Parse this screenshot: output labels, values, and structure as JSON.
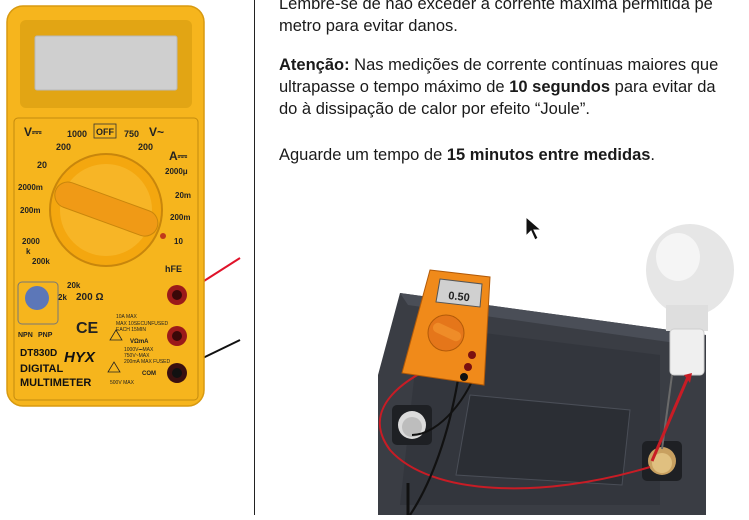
{
  "paragraph1": {
    "line1": "Lembre-se de não exceder a corrente máxima permitida pe",
    "line2": "metro para evitar danos."
  },
  "paragraph2": {
    "label": "Atenção:",
    "line1_rest": " Nas medições de corrente contínuas maiores que",
    "line2_pre": "ultrapasse o tempo máximo de ",
    "line2_bold": "10 segundos",
    "line2_post": " para evitar da",
    "line3": "do à dissipação de calor por efeito “Joule”."
  },
  "paragraph3": {
    "pre": "Aguarde um tempo de ",
    "bold": "15 minutos entre medidas",
    "post": "."
  },
  "multimeter": {
    "off": "OFF",
    "vdc": "V⎓",
    "vac": "V~",
    "adc": "A⎓",
    "r1000a": "1000",
    "r750": "750",
    "r200a": "200",
    "r200b": "200",
    "r20": "20",
    "r2000m": "2000m",
    "r200m": "200m",
    "r2000k": "2000",
    "k": "k",
    "r200k": "200k",
    "r20k": "20k",
    "r2k": "2k",
    "ohm": "200 Ω",
    "a2000u": "2000μ",
    "a20m": "20m",
    "a200m": "200m",
    "a10": "10",
    "hfe": "hFE",
    "npn": "NPN",
    "pnp": "PNP",
    "ce": "CE",
    "model": "DT830D",
    "brand": "HYX",
    "digital": "DIGITAL",
    "multimeter_word": "MULTIMETER",
    "jack_10a": "10A MAX",
    "jack_vma": "VΩmA",
    "jack_com": "COM",
    "small_print_1": "MAX 10SEC",
    "small_print_2": "EACH 15MIN",
    "small_print_3": "UNFUSED",
    "small_print_4": "1000V⎓MAX",
    "small_print_5": "750V~MAX",
    "small_print_6": "200mA MAX FUSED",
    "small_print_7": "500V MAX"
  },
  "scene": {
    "display_value": "0.50"
  },
  "colors": {
    "meter_yellow": "#f6b51d",
    "meter_orange": "#f08a1a",
    "lcd_gray": "#cfcfcf",
    "probe_red": "#e01b2a",
    "battery_dark": "#3a3d44"
  }
}
